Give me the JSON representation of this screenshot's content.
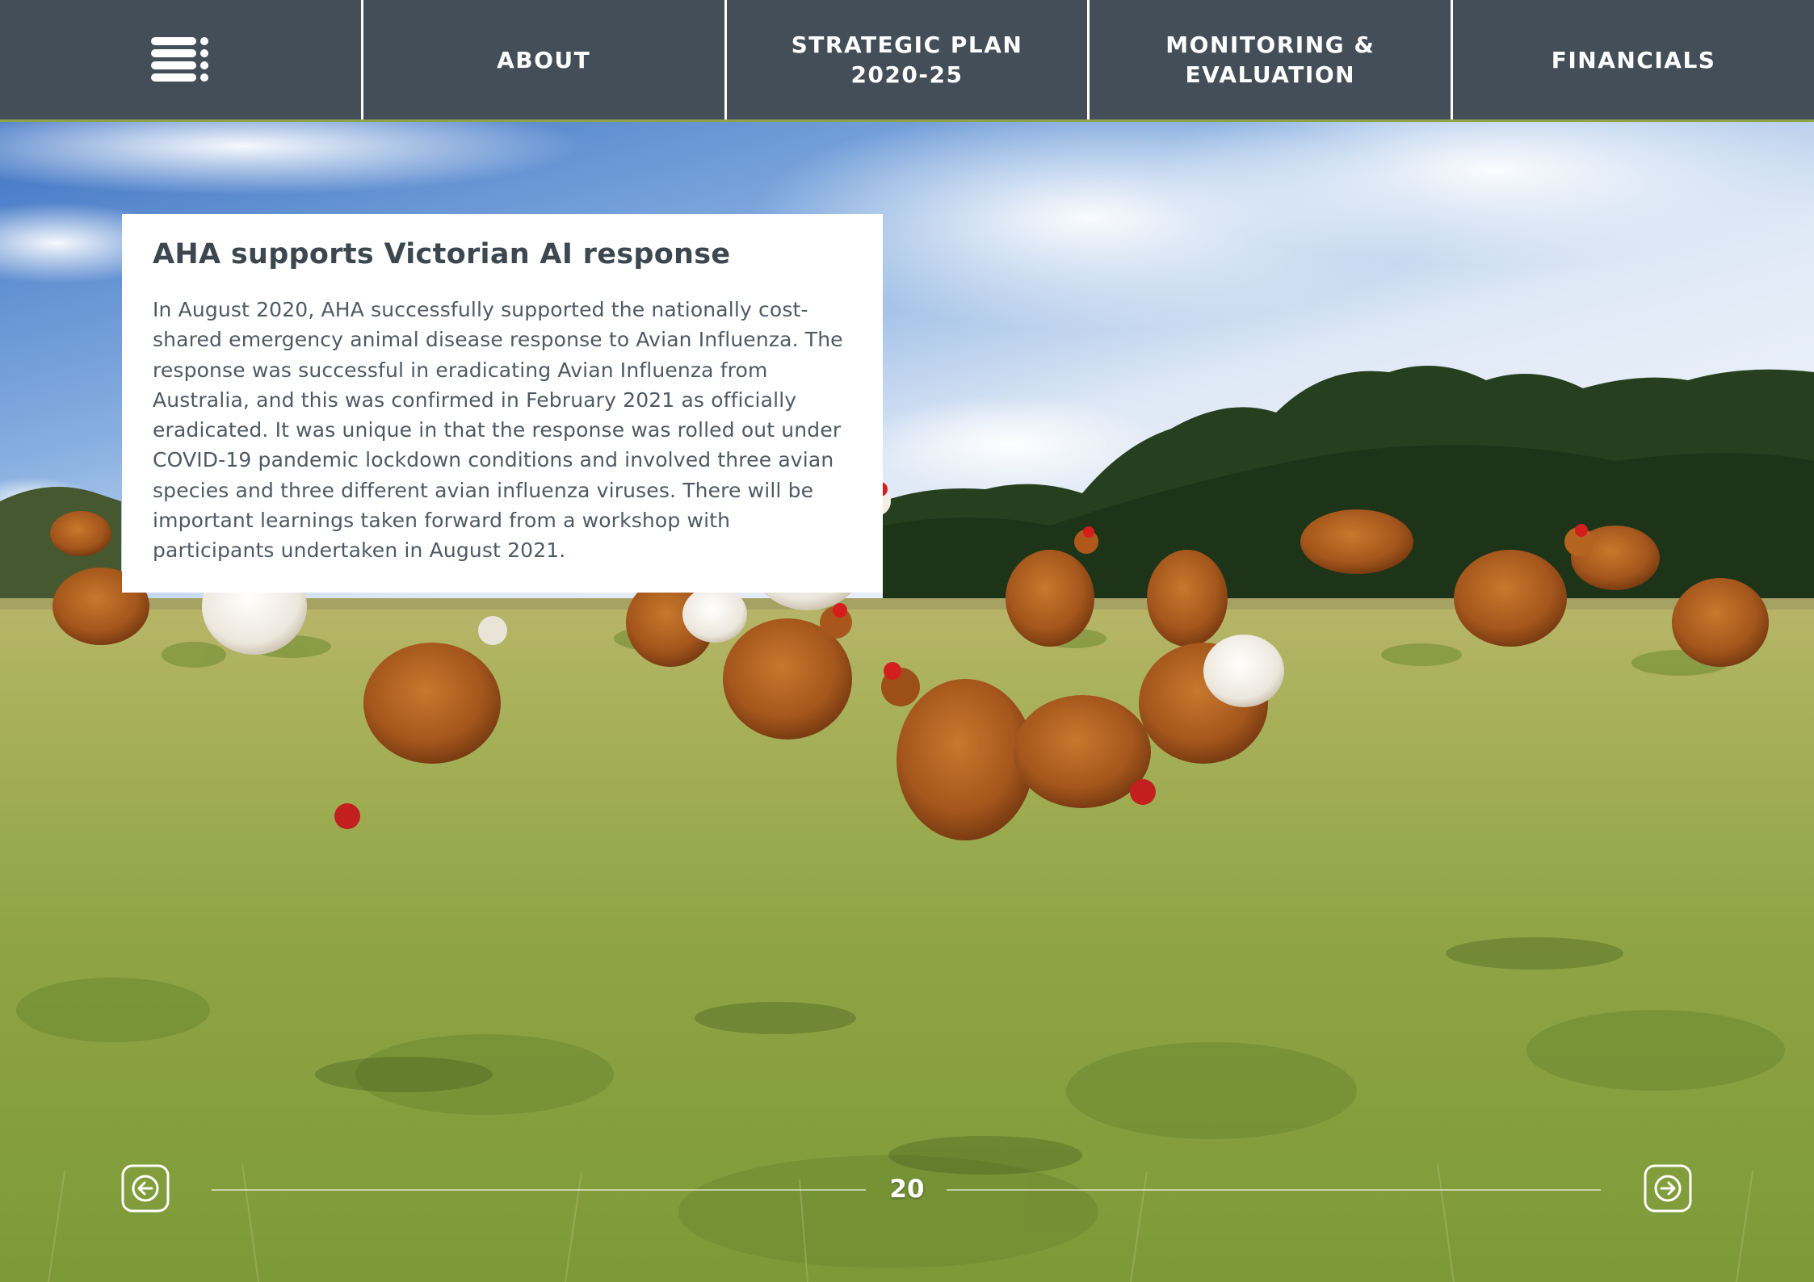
{
  "nav": {
    "items": [
      {
        "label": "ABOUT"
      },
      {
        "label": "STRATEGIC PLAN\n2020-25"
      },
      {
        "label": "MONITORING &\nEVALUATION"
      },
      {
        "label": "FINANCIALS"
      }
    ]
  },
  "article": {
    "title": "AHA supports Victorian AI response",
    "body": "In August 2020, AHA successfully supported the nationally cost-shared emergency animal disease response to Avian Influenza. The response was successful in eradicating Avian Influenza from Australia, and this was confirmed in February 2021 as officially eradicated. It was unique in that the response was rolled out under COVID-19 pandemic lockdown conditions and involved three avian species and three different avian influenza viruses. There will be important learnings taken forward from a workshop with participants undertaken in August 2021."
  },
  "footer": {
    "page_number": "20"
  },
  "icons": {
    "menu": "menu-icon",
    "previous": "arrow-left-icon",
    "next": "arrow-right-icon"
  },
  "colors": {
    "nav_background": "#434e58",
    "nav_text": "#ffffff",
    "title_text": "#3c4750",
    "body_text": "#4f5963"
  }
}
